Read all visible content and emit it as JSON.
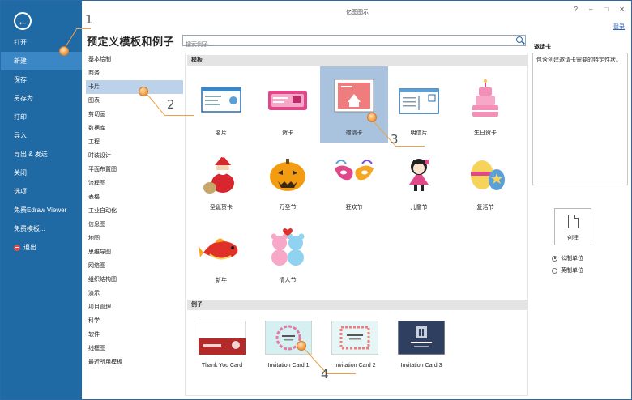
{
  "window": {
    "title": "亿图图示",
    "login": "登录"
  },
  "backstage": {
    "items": [
      "打开",
      "新建",
      "保存",
      "另存为",
      "打印",
      "导入",
      "导出 & 发送",
      "关闭",
      "选项",
      "免费Edraw Viewer",
      "免费模板...",
      "退出"
    ],
    "active_index": 1
  },
  "page": {
    "heading": "预定义模板和例子"
  },
  "search": {
    "placeholder": "搜索例子..."
  },
  "categories": {
    "items": [
      "基本绘制",
      "商务",
      "卡片",
      "图表",
      "剪切画",
      "数据库",
      "工程",
      "时装设计",
      "平面布置图",
      "流程图",
      "表格",
      "工业自动化",
      "信息图",
      "地图",
      "思维导图",
      "网络图",
      "组织结构图",
      "演示",
      "项目管理",
      "科学",
      "软件",
      "线框图",
      "最近所用模板"
    ],
    "selected_index": 2
  },
  "templates": {
    "section": "模板",
    "items": [
      "名片",
      "贺卡",
      "邀请卡",
      "明信片",
      "生日贺卡",
      "圣诞贺卡",
      "万圣节",
      "狂欢节",
      "儿童节",
      "复活节",
      "新年",
      "情人节"
    ],
    "selected_index": 2
  },
  "examples": {
    "section": "例子",
    "items": [
      "Thank You Card",
      "Invitation Card 1",
      "Invitation Card 2",
      "Invitation Card 3"
    ]
  },
  "right_panel": {
    "title": "邀请卡",
    "description": "包含创建邀请卡需要的特定性状。",
    "create_label": "创建",
    "units": [
      {
        "label": "公制单位",
        "selected": true
      },
      {
        "label": "英制单位",
        "selected": false
      }
    ]
  },
  "callouts": [
    "1",
    "2",
    "3",
    "4"
  ],
  "colors": {
    "sidebar": "#1f6aa5",
    "accent": "#f0953b",
    "selected": "#a9c2dd"
  }
}
